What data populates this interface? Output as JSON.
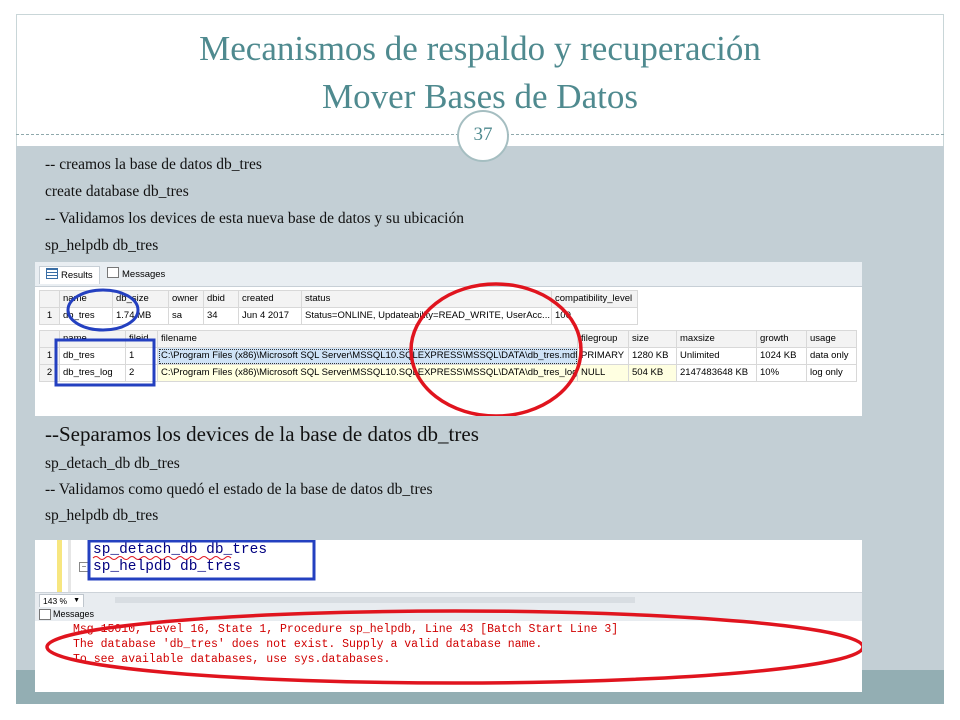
{
  "slide": {
    "title_line1": "Mecanismos de respaldo y recuperación",
    "title_line2": "Mover Bases de Datos",
    "page_number": "37",
    "lines": [
      "-- creamos la base de datos db_tres",
      "create database db_tres",
      "-- Validamos los devices de esta nueva base de datos y su ubicación",
      "sp_helpdb db_tres",
      "--Separamos los devices de la base  de datos db_tres",
      "sp_detach_db db_tres",
      "-- Validamos como quedó el estado de la base de datos db_tres",
      "sp_helpdb db_tres"
    ]
  },
  "screenshot1": {
    "tabs": [
      "Results",
      "Messages"
    ],
    "grid1": {
      "headers": [
        "name",
        "db_size",
        "owner",
        "dbid",
        "created",
        "status",
        "compatibility_level"
      ],
      "rows": [
        [
          "1",
          "db_tres",
          "1.74 MB",
          "sa",
          "34",
          "Jun  4 2017",
          "Status=ONLINE, Updateability=READ_WRITE, UserAcc...",
          "100"
        ]
      ]
    },
    "grid2": {
      "headers": [
        "name",
        "fileid",
        "filename",
        "filegroup",
        "size",
        "maxsize",
        "growth",
        "usage"
      ],
      "rows": [
        [
          "1",
          "db_tres",
          "1",
          "C:\\Program Files (x86)\\Microsoft SQL Server\\MSSQL10.SQLEXPRESS\\MSSQL\\DATA\\db_tres.mdf",
          "PRIMARY",
          "1280 KB",
          "Unlimited",
          "1024 KB",
          "data only"
        ],
        [
          "2",
          "db_tres_log",
          "2",
          "C:\\Program Files (x86)\\Microsoft SQL Server\\MSSQL10.SQLEXPRESS\\MSSQL\\DATA\\db_tres_log....",
          "NULL",
          "504 KB",
          "2147483648 KB",
          "10%",
          "log only"
        ]
      ]
    }
  },
  "screenshot2": {
    "code_lines": [
      "sp_detach_db db_tres",
      "sp_helpdb db_tres"
    ],
    "zoom": "143 %",
    "messages_tab": "Messages",
    "messages": [
      "Msg 15010, Level 16, State 1, Procedure sp_helpdb, Line 43 [Batch Start Line 3]",
      "The database 'db_tres' does not exist. Supply a valid database name.",
      "To see available databases, use sys.databases."
    ]
  },
  "colors": {
    "title": "#4f8a8f",
    "content_background": "#c3cfd5",
    "annotation_blue": "#2440c0",
    "annotation_red": "#e0141e",
    "error_text": "#d00000"
  }
}
